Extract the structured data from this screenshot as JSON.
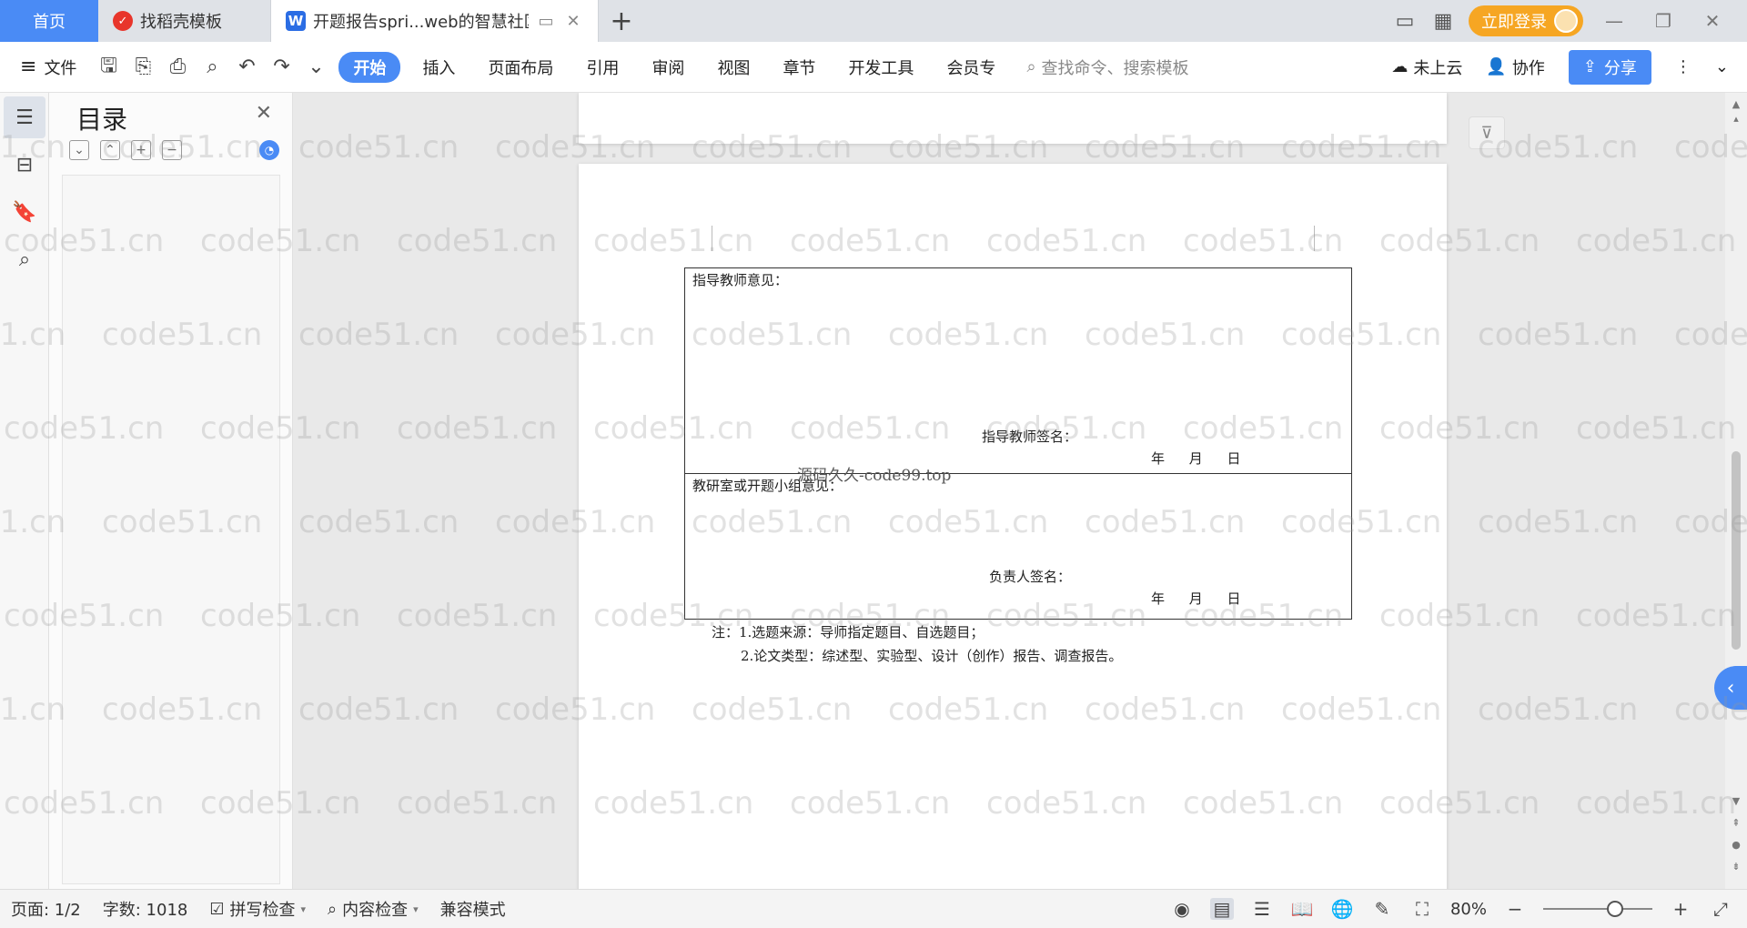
{
  "tabs": {
    "home": "首页",
    "template": "找稻壳模板",
    "doc": "开题报告spri...web的智慧社区",
    "new_tab_icon": "plus-icon"
  },
  "titlebar": {
    "login_label": "立即登录"
  },
  "ribbon": {
    "file_label": "文件",
    "tabs": [
      "开始",
      "插入",
      "页面布局",
      "引用",
      "审阅",
      "视图",
      "章节",
      "开发工具",
      "会员专"
    ],
    "search_placeholder": "查找命令、搜索模板",
    "cloud_label": "未上云",
    "collab_label": "协作",
    "share_label": "分享"
  },
  "toc": {
    "title": "目录"
  },
  "document": {
    "advisor_opinion_label": "指导教师意见：",
    "advisor_sign_label": "指导教师签名：",
    "date_text": "年 月 日",
    "group_opinion_label": "教研室或开题小组意见：",
    "leader_sign_label": "负责人签名：",
    "stamp_text": "源码久久-code99.top",
    "note_line1": "注：1.选题来源：导师指定题目、自选题目；",
    "note_line2": "2.论文类型：综述型、实验型、设计（创作）报告、调查报告。"
  },
  "statusbar": {
    "page": "页面: 1/2",
    "word_count": "字数: 1018",
    "spell_check": "拼写检查",
    "content_check": "内容检查",
    "compat_mode": "兼容模式",
    "zoom": "80%"
  },
  "watermark_text": "code51.cn",
  "colors": {
    "accent": "#4a8bf5",
    "login": "#f6a623",
    "wps_red": "#e8352b"
  }
}
